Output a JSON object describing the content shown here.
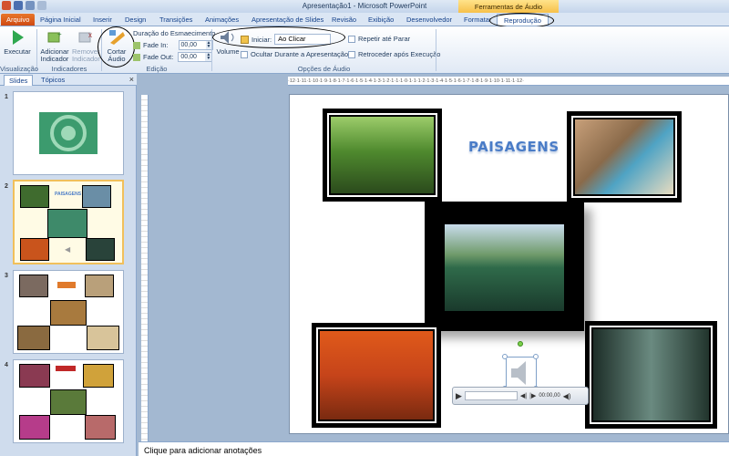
{
  "window": {
    "title": "Apresentação1 - Microsoft PowerPoint",
    "context_group": "Ferramentas de Áudio"
  },
  "tabs": [
    "Arquivo",
    "Página Inicial",
    "Inserir",
    "Design",
    "Transições",
    "Animações",
    "Apresentação de Slides",
    "Revisão",
    "Exibição",
    "Desenvolvedor",
    "Formatar",
    "Reprodução"
  ],
  "ribbon": {
    "play_label": "Executar",
    "add_bookmark_label": "Adicionar Indicador",
    "remove_bookmark_label": "Remover Indicador",
    "trim_audio_label": "Cortar Áudio",
    "fade_duration_label": "Duração do Esmaecimento",
    "fade_in_label": "Fade In:",
    "fade_in_value": "00,00",
    "fade_out_label": "Fade Out:",
    "fade_out_value": "00,00",
    "volume_label": "Volume",
    "start_label": "Iniciar:",
    "start_value": "Ao Clicar",
    "hide_during_show_label": "Ocultar Durante a Apresentação",
    "loop_label": "Repetir até Parar",
    "rewind_label": "Retroceder após Execução",
    "groups": {
      "preview": "Visualização",
      "bookmarks": "Indicadores",
      "editing": "Edição",
      "audio_options": "Opções de Áudio"
    }
  },
  "pane": {
    "tab_slides": "Slides",
    "tab_outline": "Tópicos",
    "close_glyph": "×",
    "slide_numbers": [
      "1",
      "2",
      "3",
      "4"
    ]
  },
  "slide": {
    "title": "PAISAGENS",
    "player_time": "00:00,00"
  },
  "ruler": "·12·1·11·1·10·1·9·1·8·1·7·1·6·1·5·1·4·1·3·1·2·1·1·1·0·1·1·1·2·1·3·1·4·1·5·1·6·1·7·1·8·1·9·1·10·1·11·1·12·",
  "notes_placeholder": "Clique para adicionar anotações",
  "colors": {
    "file_tab": "#e0612a",
    "context_tab": "#f6c04a",
    "slide_title": "#4a7cc7"
  }
}
